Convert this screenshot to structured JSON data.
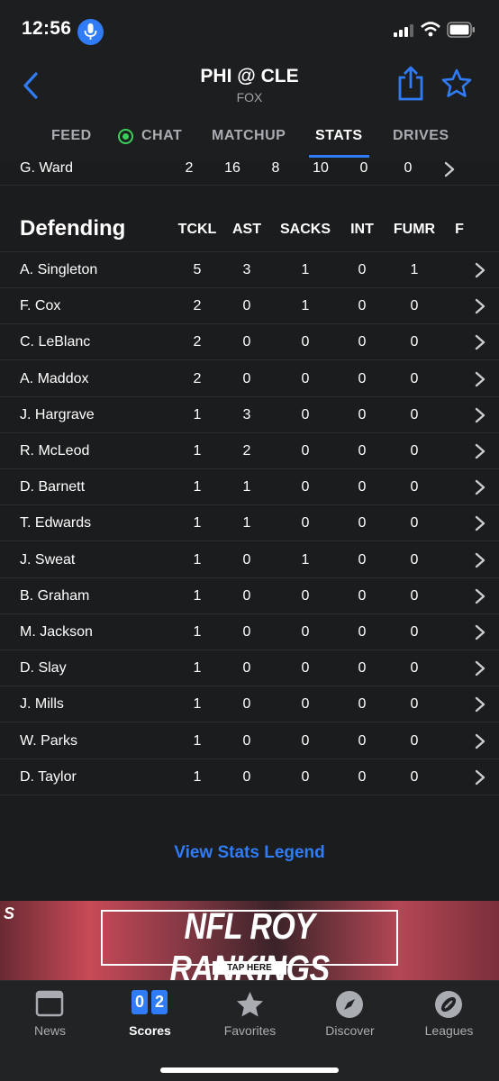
{
  "status_bar": {
    "time": "12:56"
  },
  "header": {
    "title": "PHI @ CLE",
    "network": "FOX",
    "tabs": [
      {
        "label": "FEED"
      },
      {
        "label": "CHAT"
      },
      {
        "label": "MATCHUP"
      },
      {
        "label": "STATS"
      },
      {
        "label": "DRIVES"
      }
    ],
    "active_tab": "STATS"
  },
  "previous_row": {
    "name": "G. Ward",
    "values": [
      "2",
      "16",
      "8",
      "10",
      "0",
      "0"
    ]
  },
  "defending": {
    "title": "Defending",
    "columns": [
      "TCKL",
      "AST",
      "SACKS",
      "INT",
      "FUMR",
      "F"
    ],
    "rows": [
      {
        "name": "A. Singleton",
        "values": [
          "5",
          "3",
          "1",
          "0",
          "1"
        ]
      },
      {
        "name": "F. Cox",
        "values": [
          "2",
          "0",
          "1",
          "0",
          "0"
        ]
      },
      {
        "name": "C. LeBlanc",
        "values": [
          "2",
          "0",
          "0",
          "0",
          "0"
        ]
      },
      {
        "name": "A. Maddox",
        "values": [
          "2",
          "0",
          "0",
          "0",
          "0"
        ]
      },
      {
        "name": "J. Hargrave",
        "values": [
          "1",
          "3",
          "0",
          "0",
          "0"
        ]
      },
      {
        "name": "R. McLeod",
        "values": [
          "1",
          "2",
          "0",
          "0",
          "0"
        ]
      },
      {
        "name": "D. Barnett",
        "values": [
          "1",
          "1",
          "0",
          "0",
          "0"
        ]
      },
      {
        "name": "T. Edwards",
        "values": [
          "1",
          "1",
          "0",
          "0",
          "0"
        ]
      },
      {
        "name": "J. Sweat",
        "values": [
          "1",
          "0",
          "1",
          "0",
          "0"
        ]
      },
      {
        "name": "B. Graham",
        "values": [
          "1",
          "0",
          "0",
          "0",
          "0"
        ]
      },
      {
        "name": "M. Jackson",
        "values": [
          "1",
          "0",
          "0",
          "0",
          "0"
        ]
      },
      {
        "name": "D. Slay",
        "values": [
          "1",
          "0",
          "0",
          "0",
          "0"
        ]
      },
      {
        "name": "J. Mills",
        "values": [
          "1",
          "0",
          "0",
          "0",
          "0"
        ]
      },
      {
        "name": "W. Parks",
        "values": [
          "1",
          "0",
          "0",
          "0",
          "0"
        ]
      },
      {
        "name": "D. Taylor",
        "values": [
          "1",
          "0",
          "0",
          "0",
          "0"
        ]
      }
    ]
  },
  "legend_link": "View Stats Legend",
  "banner": {
    "brand": "S",
    "headline": "NFL ROY RANKINGS",
    "cta": "TAP HERE"
  },
  "tabbar": {
    "items": [
      {
        "label": "News",
        "icon": "news-icon"
      },
      {
        "label": "Scores",
        "icon": "scores-icon",
        "score_digits": [
          "0",
          "2"
        ]
      },
      {
        "label": "Favorites",
        "icon": "star-icon"
      },
      {
        "label": "Discover",
        "icon": "compass-icon"
      },
      {
        "label": "Leagues",
        "icon": "football-icon"
      }
    ],
    "active": "Scores"
  },
  "colors": {
    "accent": "#2f7cf6",
    "background": "#1b1c1e",
    "live_dot": "#3bcf5a"
  }
}
